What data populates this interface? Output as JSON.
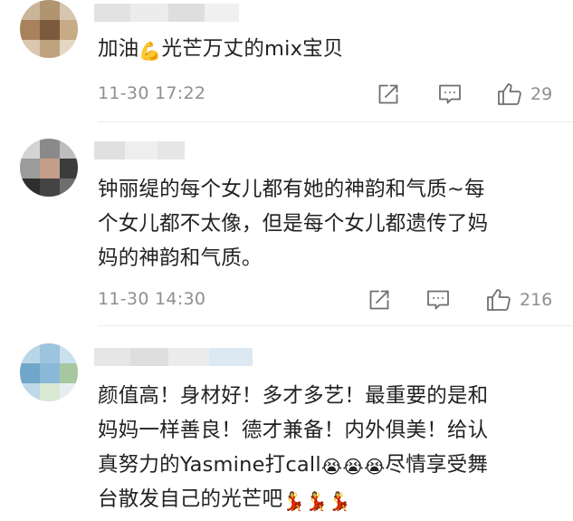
{
  "comments": [
    {
      "lines": [
        "加油",
        "光芒万丈的mix宝贝"
      ],
      "emoji": "💪",
      "time": "11-30 17:22",
      "likes": "29"
    },
    {
      "lines": [
        "钟丽缇的每个女儿都有她的神韵和气质~每",
        "个女儿都不太像，但是每个女儿都遗传了妈",
        "妈的神韵和气质。"
      ],
      "time": "11-30 14:30",
      "likes": "216"
    },
    {
      "lines": [
        "颜值高！身材好！多才多艺！最重要的是和",
        "妈妈一样善良！德才兼备！内外俱美！给认",
        "真努力的Yasmine打call",
        "尽情享受舞",
        "台散发自己的光芒吧"
      ],
      "emoji_cheer": "😭",
      "emoji_dance": "💃"
    }
  ],
  "icons": {
    "share": "share-icon",
    "reply": "comment-icon",
    "like": "thumbs-up-icon"
  },
  "colors": {
    "meta_gray": "#8f8f8f",
    "divider": "#ececec"
  }
}
